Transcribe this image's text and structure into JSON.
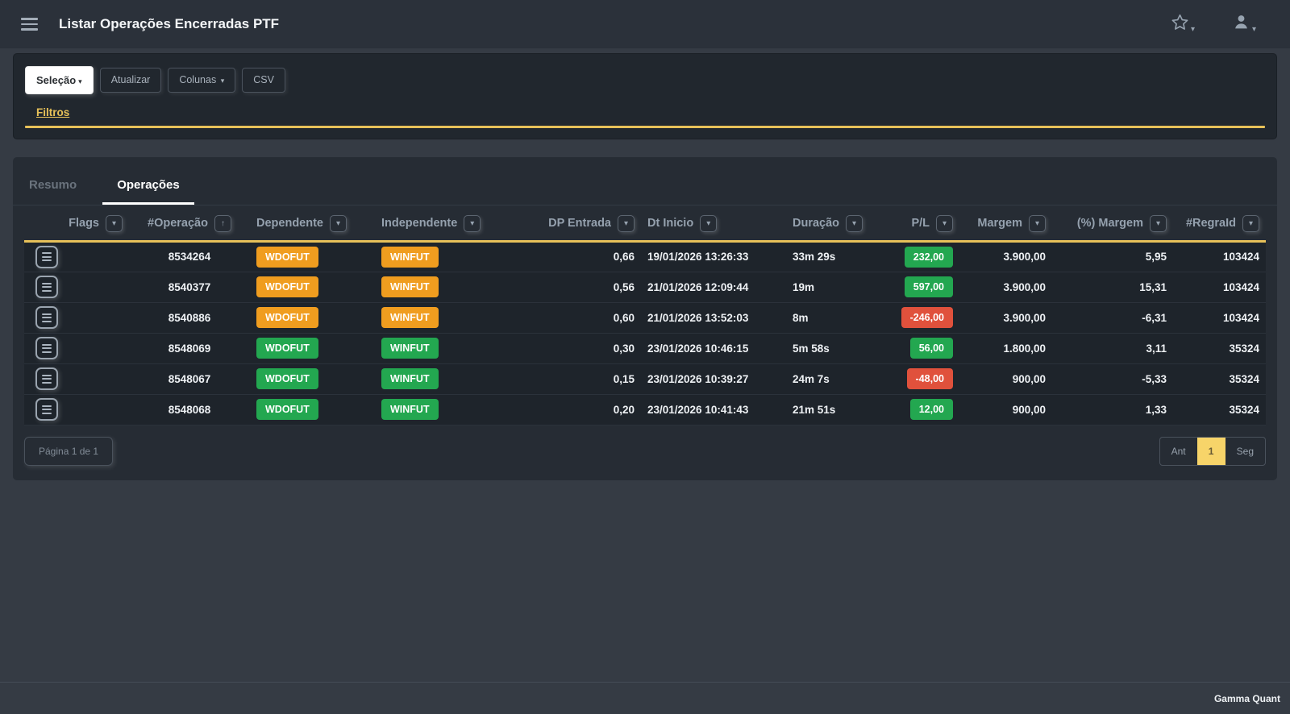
{
  "navbar": {
    "title": "Listar Operações Encerradas PTF"
  },
  "toolbar": {
    "selecao_label": "Seleção",
    "atualizar_label": "Atualizar",
    "colunas_label": "Colunas",
    "csv_label": "CSV",
    "filtros_label": "Filtros"
  },
  "tabs": [
    {
      "label": "Resumo",
      "active": false
    },
    {
      "label": "Operações",
      "active": true
    }
  ],
  "icons": {
    "menu": "hamburger-menu",
    "favorites": "star-outline",
    "user": "person-silhouette",
    "caret_down": "▾",
    "sort_asc": "↑",
    "row_menu": "list-lines"
  },
  "colors": {
    "orange": "#f09d1f",
    "green": "#23a750",
    "red": "#e0513c",
    "accent_gold": "#e7c159",
    "pagination_active": "#f7d469"
  },
  "table": {
    "columns": [
      {
        "key": "flags",
        "label": "Flags",
        "control": "filter",
        "align": "right",
        "type": "action"
      },
      {
        "key": "operacao",
        "label": "#Operação",
        "control": "sort-asc",
        "align": "center",
        "type": "text"
      },
      {
        "key": "dependente",
        "label": "Dependente",
        "control": "filter",
        "align": "left",
        "type": "badge",
        "color_key": "dependente_color"
      },
      {
        "key": "independente",
        "label": "Independente",
        "control": "filter",
        "align": "left",
        "type": "badge",
        "color_key": "independente_color"
      },
      {
        "key": "dp_entrada",
        "label": "DP Entrada",
        "control": "filter",
        "align": "right",
        "type": "text"
      },
      {
        "key": "dt_inicio",
        "label": "Dt Inicio",
        "control": "filter",
        "align": "left",
        "type": "text"
      },
      {
        "key": "duracao",
        "label": "Duração",
        "control": "filter",
        "align": "left",
        "type": "text"
      },
      {
        "key": "pl",
        "label": "P/L",
        "control": "filter",
        "align": "right",
        "type": "badge",
        "color_key": "pl_color"
      },
      {
        "key": "margem",
        "label": "Margem",
        "control": "filter",
        "align": "right",
        "type": "text"
      },
      {
        "key": "pct_margem",
        "label": "(%) Margem",
        "control": "filter",
        "align": "right",
        "type": "text"
      },
      {
        "key": "regraid",
        "label": "#RegraId",
        "control": "filter",
        "align": "right",
        "type": "text"
      }
    ],
    "rows": [
      {
        "operacao": "8534264",
        "dependente": "WDOFUT",
        "dependente_color": "orange",
        "independente": "WINFUT",
        "independente_color": "orange",
        "dp_entrada": "0,66",
        "dt_inicio": "19/01/2026 13:26:33",
        "duracao": "33m 29s",
        "pl": "232,00",
        "pl_color": "green",
        "margem": "3.900,00",
        "pct_margem": "5,95",
        "regraid": "103424"
      },
      {
        "operacao": "8540377",
        "dependente": "WDOFUT",
        "dependente_color": "orange",
        "independente": "WINFUT",
        "independente_color": "orange",
        "dp_entrada": "0,56",
        "dt_inicio": "21/01/2026 12:09:44",
        "duracao": "19m",
        "pl": "597,00",
        "pl_color": "green",
        "margem": "3.900,00",
        "pct_margem": "15,31",
        "regraid": "103424"
      },
      {
        "operacao": "8540886",
        "dependente": "WDOFUT",
        "dependente_color": "orange",
        "independente": "WINFUT",
        "independente_color": "orange",
        "dp_entrada": "0,60",
        "dt_inicio": "21/01/2026 13:52:03",
        "duracao": "8m",
        "pl": "-246,00",
        "pl_color": "red",
        "margem": "3.900,00",
        "pct_margem": "-6,31",
        "regraid": "103424"
      },
      {
        "operacao": "8548069",
        "dependente": "WDOFUT",
        "dependente_color": "green",
        "independente": "WINFUT",
        "independente_color": "green",
        "dp_entrada": "0,30",
        "dt_inicio": "23/01/2026 10:46:15",
        "duracao": "5m 58s",
        "pl": "56,00",
        "pl_color": "green",
        "margem": "1.800,00",
        "pct_margem": "3,11",
        "regraid": "35324"
      },
      {
        "operacao": "8548067",
        "dependente": "WDOFUT",
        "dependente_color": "green",
        "independente": "WINFUT",
        "independente_color": "green",
        "dp_entrada": "0,15",
        "dt_inicio": "23/01/2026 10:39:27",
        "duracao": "24m 7s",
        "pl": "-48,00",
        "pl_color": "red",
        "margem": "900,00",
        "pct_margem": "-5,33",
        "regraid": "35324"
      },
      {
        "operacao": "8548068",
        "dependente": "WDOFUT",
        "dependente_color": "green",
        "independente": "WINFUT",
        "independente_color": "green",
        "dp_entrada": "0,20",
        "dt_inicio": "23/01/2026 10:41:43",
        "duracao": "21m 51s",
        "pl": "12,00",
        "pl_color": "green",
        "margem": "900,00",
        "pct_margem": "1,33",
        "regraid": "35324"
      }
    ]
  },
  "pagination": {
    "page_info": "Página 1 de 1",
    "prev_label": "Ant",
    "current_page": "1",
    "next_label": "Seg"
  },
  "footer": {
    "brand": "Gamma Quant"
  }
}
